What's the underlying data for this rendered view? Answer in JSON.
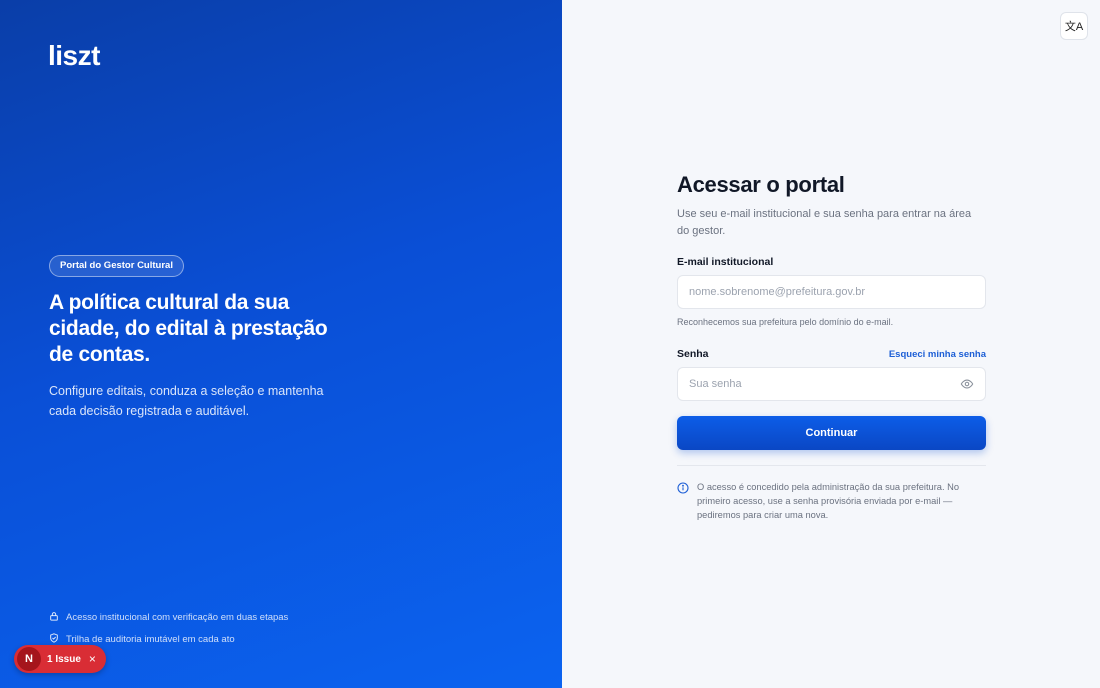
{
  "brand": {
    "logo": "liszt"
  },
  "hero": {
    "badge": "Portal do Gestor Cultural",
    "headline": "A política cultural da sua cidade, do edital à prestação de contas.",
    "lead": "Configure editais, conduza a seleção e mantenha cada decisão registrada e auditável.",
    "features": [
      {
        "icon": "lock-icon",
        "text": "Acesso institucional com verificação em duas etapas"
      },
      {
        "icon": "shield-icon",
        "text": "Trilha de auditoria imutável em cada ato"
      }
    ]
  },
  "devtools": {
    "badge_letter": "N",
    "issue_label": "1 Issue",
    "close": "×"
  },
  "language_button": {
    "icon": "translate-icon",
    "glyph": "文A"
  },
  "login": {
    "title": "Acessar o portal",
    "subtitle": "Use seu e-mail institucional e sua senha para entrar na área do gestor.",
    "email_label": "E-mail institucional",
    "email_placeholder": "nome.sobrenome@prefeitura.gov.br",
    "email_hint": "Reconhecemos sua prefeitura pelo domínio do e-mail.",
    "password_label": "Senha",
    "forgot_link": "Esqueci minha senha",
    "password_placeholder": "Sua senha",
    "submit_label": "Continuar",
    "info_note": "O acesso é concedido pela administração da sua prefeitura. No primeiro acesso, use a senha provisória enviada por e-mail — pediremos para criar uma nova."
  }
}
